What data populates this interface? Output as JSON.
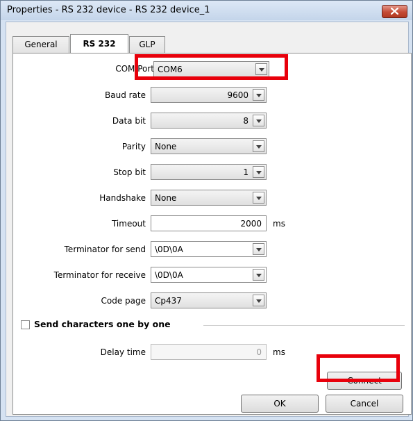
{
  "window": {
    "title": "Properties - RS 232 device - RS 232 device_1",
    "close_icon": "close-icon"
  },
  "tabs": [
    {
      "label": "General",
      "active": false
    },
    {
      "label": "RS 232",
      "active": true
    },
    {
      "label": "GLP",
      "active": false
    }
  ],
  "fields": {
    "com_port": {
      "label": "COM Port",
      "value": "COM6"
    },
    "baud_rate": {
      "label": "Baud rate",
      "value": "9600"
    },
    "data_bit": {
      "label": "Data bit",
      "value": "8"
    },
    "parity": {
      "label": "Parity",
      "value": "None"
    },
    "stop_bit": {
      "label": "Stop bit",
      "value": "1"
    },
    "handshake": {
      "label": "Handshake",
      "value": "None"
    },
    "timeout": {
      "label": "Timeout",
      "value": "2000",
      "unit": "ms"
    },
    "terminator_send": {
      "label": "Terminator for send",
      "value": "\\0D\\0A"
    },
    "terminator_receive": {
      "label": "Terminator for receive",
      "value": "\\0D\\0A"
    },
    "code_page": {
      "label": "Code page",
      "value": "Cp437"
    }
  },
  "send_one_by_one": {
    "label": "Send characters one by one",
    "checked": false
  },
  "delay_time": {
    "label": "Delay time",
    "value": "0",
    "unit": "ms"
  },
  "buttons": {
    "connect": "Connect",
    "ok": "OK",
    "cancel": "Cancel"
  },
  "highlight_color": "#e8000b"
}
